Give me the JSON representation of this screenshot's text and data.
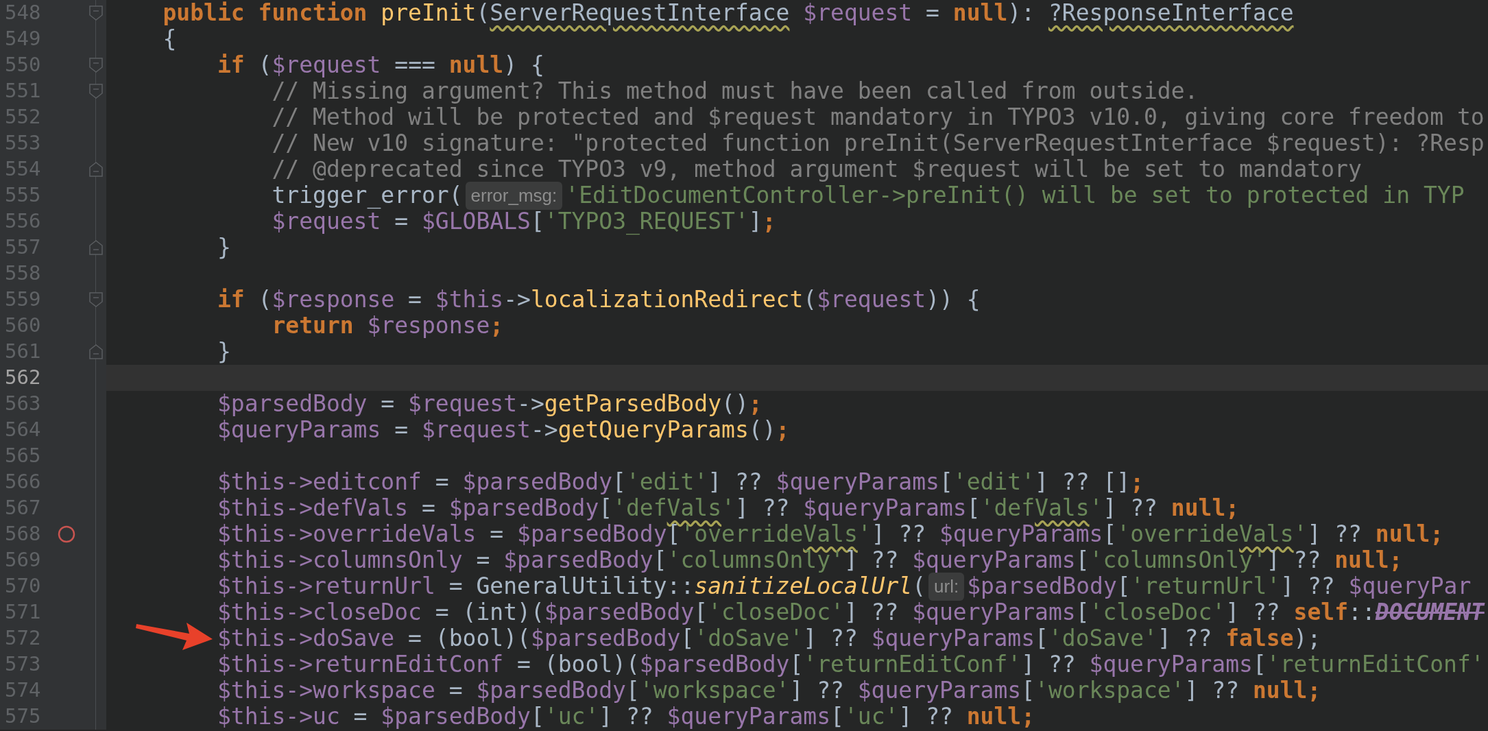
{
  "lines": [
    {
      "number": "548",
      "current": false,
      "breakpoint": false,
      "arrow": false,
      "fold_open": true,
      "fold_close": false,
      "tokens": [
        {
          "kind": "keyword",
          "text": "public function "
        },
        {
          "kind": "function",
          "text": "preInit"
        },
        {
          "kind": "plain",
          "text": "("
        },
        {
          "kind": "warning",
          "text": "ServerRequestInterface"
        },
        {
          "kind": "variable",
          "text": " $request"
        },
        {
          "kind": "plain",
          "text": " = "
        },
        {
          "kind": "keyword",
          "text": "null"
        },
        {
          "kind": "plain",
          "text": "): "
        },
        {
          "kind": "warning",
          "text": "?ResponseInterface"
        }
      ]
    },
    {
      "number": "549",
      "current": false,
      "breakpoint": false,
      "arrow": false,
      "fold_open": false,
      "fold_close": false,
      "tokens": [
        {
          "kind": "plain",
          "text": "{"
        }
      ],
      "children": [
        {
          "number": "550",
          "current": false,
          "breakpoint": false,
          "arrow": false,
          "fold_open": true,
          "fold_close": false,
          "tokens": [
            {
              "kind": "keyword",
              "text": "if"
            },
            {
              "kind": "plain",
              "text": " ("
            },
            {
              "kind": "variable",
              "text": "$request"
            },
            {
              "kind": "plain",
              "text": " === "
            },
            {
              "kind": "keyword",
              "text": "null"
            },
            {
              "kind": "plain",
              "text": ") {"
            }
          ],
          "children": [
            {
              "number": "551",
              "current": false,
              "breakpoint": false,
              "arrow": false,
              "fold_open": true,
              "fold_close": false,
              "tokens": [
                {
                  "kind": "comment",
                  "text": "// Missing argument? This method must have been called from outside."
                }
              ]
            },
            {
              "number": "552",
              "current": false,
              "breakpoint": false,
              "arrow": false,
              "fold_open": false,
              "fold_close": false,
              "tokens": [
                {
                  "kind": "comment",
                  "text": "// Method will be protected and $request mandatory in TYPO3 v10.0, giving core freedom to"
                }
              ]
            },
            {
              "number": "553",
              "current": false,
              "breakpoint": false,
              "arrow": false,
              "fold_open": false,
              "fold_close": false,
              "tokens": [
                {
                  "kind": "comment",
                  "text": "// New v10 signature: \"protected function preInit(ServerRequestInterface $request): ?Resp"
                }
              ]
            },
            {
              "number": "554",
              "current": false,
              "breakpoint": false,
              "arrow": false,
              "fold_open": false,
              "fold_close": true,
              "tokens": [
                {
                  "kind": "comment",
                  "text": "// @deprecated since TYPO3 v9, method argument $request will be set to mandatory"
                }
              ]
            },
            {
              "number": "555",
              "current": false,
              "breakpoint": false,
              "arrow": false,
              "fold_open": false,
              "fold_close": false,
              "tokens": [
                {
                  "kind": "plain",
                  "text": "trigger_error("
                },
                {
                  "kind": "hint",
                  "text": "error_msg:"
                },
                {
                  "kind": "string",
                  "text": "'EditDocumentController->preInit() will be set to protected in TYP"
                }
              ]
            },
            {
              "number": "556",
              "current": false,
              "breakpoint": false,
              "arrow": false,
              "fold_open": false,
              "fold_close": false,
              "tokens": [
                {
                  "kind": "variable",
                  "text": "$request"
                },
                {
                  "kind": "plain",
                  "text": " = "
                },
                {
                  "kind": "variable",
                  "text": "$GLOBALS"
                },
                {
                  "kind": "plain",
                  "text": "["
                },
                {
                  "kind": "string",
                  "text": "'TYPO3_REQUEST'"
                },
                {
                  "kind": "plain",
                  "text": "]"
                },
                {
                  "kind": "keyword",
                  "text": ";"
                }
              ]
            }
          ]
        },
        {
          "number": "557",
          "current": false,
          "breakpoint": false,
          "arrow": false,
          "fold_open": false,
          "fold_close": true,
          "tokens": [
            {
              "kind": "plain",
              "text": "}"
            }
          ]
        },
        {
          "number": "558",
          "current": false,
          "breakpoint": false,
          "arrow": false,
          "fold_open": false,
          "fold_close": false
        },
        {
          "number": "559",
          "current": false,
          "breakpoint": false,
          "arrow": false,
          "fold_open": true,
          "fold_close": false,
          "tokens": [
            {
              "kind": "keyword",
              "text": "if"
            },
            {
              "kind": "plain",
              "text": " ("
            },
            {
              "kind": "variable",
              "text": "$response"
            },
            {
              "kind": "plain",
              "text": " = "
            },
            {
              "kind": "variable",
              "text": "$this"
            },
            {
              "kind": "plain",
              "text": "->"
            },
            {
              "kind": "function",
              "text": "localizationRedirect"
            },
            {
              "kind": "plain",
              "text": "("
            },
            {
              "kind": "variable",
              "text": "$request"
            },
            {
              "kind": "plain",
              "text": ")) {"
            }
          ],
          "children": [
            {
              "number": "560",
              "current": false,
              "breakpoint": false,
              "arrow": false,
              "fold_open": false,
              "fold_close": false,
              "tokens": [
                {
                  "kind": "keyword",
                  "text": "return "
                },
                {
                  "kind": "variable",
                  "text": "$response"
                },
                {
                  "kind": "keyword",
                  "text": ";"
                }
              ]
            }
          ]
        },
        {
          "number": "561",
          "current": false,
          "breakpoint": false,
          "arrow": false,
          "fold_open": false,
          "fold_close": true,
          "tokens": [
            {
              "kind": "plain",
              "text": "}"
            }
          ]
        },
        {
          "number": "562",
          "current": true,
          "breakpoint": false,
          "arrow": false,
          "fold_open": false,
          "fold_close": false
        },
        {
          "number": "563",
          "current": false,
          "breakpoint": false,
          "arrow": false,
          "fold_open": false,
          "fold_close": false,
          "tokens": [
            {
              "kind": "variable",
              "text": "$parsedBody"
            },
            {
              "kind": "plain",
              "text": " = "
            },
            {
              "kind": "variable",
              "text": "$request"
            },
            {
              "kind": "plain",
              "text": "->"
            },
            {
              "kind": "function",
              "text": "getParsedBody"
            },
            {
              "kind": "plain",
              "text": "()"
            },
            {
              "kind": "keyword",
              "text": ";"
            }
          ]
        },
        {
          "number": "564",
          "current": false,
          "breakpoint": false,
          "arrow": false,
          "fold_open": false,
          "fold_close": false,
          "tokens": [
            {
              "kind": "variable",
              "text": "$queryParams"
            },
            {
              "kind": "plain",
              "text": " = "
            },
            {
              "kind": "variable",
              "text": "$request"
            },
            {
              "kind": "plain",
              "text": "->"
            },
            {
              "kind": "function",
              "text": "getQueryParams"
            },
            {
              "kind": "plain",
              "text": "()"
            },
            {
              "kind": "keyword",
              "text": ";"
            }
          ]
        },
        {
          "number": "565",
          "current": false,
          "breakpoint": false,
          "arrow": false,
          "fold_open": false,
          "fold_close": false
        },
        {
          "number": "566",
          "current": false,
          "breakpoint": false,
          "arrow": false,
          "fold_open": false,
          "fold_close": false,
          "tokens": [
            {
              "kind": "variable",
              "text": "$this->editconf"
            },
            {
              "kind": "plain",
              "text": " = "
            },
            {
              "kind": "variable",
              "text": "$parsedBody"
            },
            {
              "kind": "plain",
              "text": "["
            },
            {
              "kind": "string",
              "text": "'edit'"
            },
            {
              "kind": "plain",
              "text": "] ?? "
            },
            {
              "kind": "variable",
              "text": "$queryParams"
            },
            {
              "kind": "plain",
              "text": "["
            },
            {
              "kind": "string",
              "text": "'edit'"
            },
            {
              "kind": "plain",
              "text": "] ?? []"
            },
            {
              "kind": "keyword",
              "text": ";"
            }
          ]
        },
        {
          "number": "567",
          "current": false,
          "breakpoint": false,
          "arrow": false,
          "fold_open": false,
          "fold_close": false,
          "tokens": [
            {
              "kind": "variable",
              "text": "$this->defVals"
            },
            {
              "kind": "plain",
              "text": " = "
            },
            {
              "kind": "variable",
              "text": "$parsedBody"
            },
            {
              "kind": "plain",
              "text": "["
            },
            {
              "kind": "string",
              "text": "'def"
            },
            {
              "kind": "stringwarning",
              "text": "Vals"
            },
            {
              "kind": "string",
              "text": "'"
            },
            {
              "kind": "plain",
              "text": "] ?? "
            },
            {
              "kind": "variable",
              "text": "$queryParams"
            },
            {
              "kind": "plain",
              "text": "["
            },
            {
              "kind": "string",
              "text": "'def"
            },
            {
              "kind": "stringwarning",
              "text": "Vals"
            },
            {
              "kind": "string",
              "text": "'"
            },
            {
              "kind": "plain",
              "text": "] ?? "
            },
            {
              "kind": "keyword",
              "text": "null;"
            }
          ]
        },
        {
          "number": "568",
          "current": false,
          "breakpoint": true,
          "arrow": false,
          "fold_open": false,
          "fold_close": false,
          "tokens": [
            {
              "kind": "variable",
              "text": "$this->overrideVals"
            },
            {
              "kind": "plain",
              "text": " = "
            },
            {
              "kind": "variable",
              "text": "$parsedBody"
            },
            {
              "kind": "plain",
              "text": "["
            },
            {
              "kind": "string",
              "text": "'override"
            },
            {
              "kind": "stringwarning",
              "text": "Vals"
            },
            {
              "kind": "string",
              "text": "'"
            },
            {
              "kind": "plain",
              "text": "] ?? "
            },
            {
              "kind": "variable",
              "text": "$queryParams"
            },
            {
              "kind": "plain",
              "text": "["
            },
            {
              "kind": "string",
              "text": "'override"
            },
            {
              "kind": "stringwarning",
              "text": "Vals"
            },
            {
              "kind": "string",
              "text": "'"
            },
            {
              "kind": "plain",
              "text": "] ?? "
            },
            {
              "kind": "keyword",
              "text": "null;"
            }
          ]
        },
        {
          "number": "569",
          "current": false,
          "breakpoint": false,
          "arrow": false,
          "fold_open": false,
          "fold_close": false,
          "tokens": [
            {
              "kind": "variable",
              "text": "$this->columnsOnly"
            },
            {
              "kind": "plain",
              "text": " = "
            },
            {
              "kind": "variable",
              "text": "$parsedBody"
            },
            {
              "kind": "plain",
              "text": "["
            },
            {
              "kind": "string",
              "text": "'columnsOnly'"
            },
            {
              "kind": "plain",
              "text": "] ?? "
            },
            {
              "kind": "variable",
              "text": "$queryParams"
            },
            {
              "kind": "plain",
              "text": "["
            },
            {
              "kind": "string",
              "text": "'columnsOnly'"
            },
            {
              "kind": "plain",
              "text": "] ?? "
            },
            {
              "kind": "keyword",
              "text": "null;"
            }
          ]
        },
        {
          "number": "570",
          "current": false,
          "breakpoint": false,
          "arrow": false,
          "fold_open": false,
          "fold_close": false,
          "tokens": [
            {
              "kind": "variable",
              "text": "$this->returnUrl"
            },
            {
              "kind": "plain",
              "text": " = GeneralUtility::"
            },
            {
              "kind": "static",
              "text": "sanitizeLocalUrl"
            },
            {
              "kind": "plain",
              "text": "("
            },
            {
              "kind": "hint",
              "text": "url:"
            },
            {
              "kind": "variable",
              "text": "$parsedBody"
            },
            {
              "kind": "plain",
              "text": "["
            },
            {
              "kind": "string",
              "text": "'returnUrl'"
            },
            {
              "kind": "plain",
              "text": "] ?? "
            },
            {
              "kind": "variable",
              "text": "$queryPar"
            }
          ]
        },
        {
          "number": "571",
          "current": false,
          "breakpoint": false,
          "arrow": false,
          "fold_open": false,
          "fold_close": false,
          "tokens": [
            {
              "kind": "variable",
              "text": "$this->closeDoc"
            },
            {
              "kind": "plain",
              "text": " = (int)("
            },
            {
              "kind": "variable",
              "text": "$parsedBody"
            },
            {
              "kind": "plain",
              "text": "["
            },
            {
              "kind": "string",
              "text": "'closeDoc'"
            },
            {
              "kind": "plain",
              "text": "] ?? "
            },
            {
              "kind": "variable",
              "text": "$queryParams"
            },
            {
              "kind": "plain",
              "text": "["
            },
            {
              "kind": "string",
              "text": "'closeDoc'"
            },
            {
              "kind": "plain",
              "text": "] ?? "
            },
            {
              "kind": "keyword",
              "text": "self"
            },
            {
              "kind": "plain",
              "text": "::"
            },
            {
              "kind": "deprecated",
              "text": "DOCUMENT"
            }
          ]
        },
        {
          "number": "572",
          "current": false,
          "breakpoint": false,
          "arrow": true,
          "fold_open": false,
          "fold_close": false,
          "tokens": [
            {
              "kind": "variable",
              "text": "$this->doSave"
            },
            {
              "kind": "plain",
              "text": " = (bool)("
            },
            {
              "kind": "variable",
              "text": "$parsedBody"
            },
            {
              "kind": "plain",
              "text": "["
            },
            {
              "kind": "string",
              "text": "'doSave'"
            },
            {
              "kind": "plain",
              "text": "] ?? "
            },
            {
              "kind": "variable",
              "text": "$queryParams"
            },
            {
              "kind": "plain",
              "text": "["
            },
            {
              "kind": "string",
              "text": "'doSave'"
            },
            {
              "kind": "plain",
              "text": "] ?? "
            },
            {
              "kind": "keyword",
              "text": "false"
            },
            {
              "kind": "plain",
              "text": ");"
            }
          ]
        },
        {
          "number": "573",
          "current": false,
          "breakpoint": false,
          "arrow": false,
          "fold_open": false,
          "fold_close": false,
          "tokens": [
            {
              "kind": "variable",
              "text": "$this->returnEditConf"
            },
            {
              "kind": "plain",
              "text": " = (bool)("
            },
            {
              "kind": "variable",
              "text": "$parsedBody"
            },
            {
              "kind": "plain",
              "text": "["
            },
            {
              "kind": "string",
              "text": "'returnEditConf'"
            },
            {
              "kind": "plain",
              "text": "] ?? "
            },
            {
              "kind": "variable",
              "text": "$queryParams"
            },
            {
              "kind": "plain",
              "text": "["
            },
            {
              "kind": "string",
              "text": "'returnEditConf'"
            }
          ]
        },
        {
          "number": "574",
          "current": false,
          "breakpoint": false,
          "arrow": false,
          "fold_open": false,
          "fold_close": false,
          "tokens": [
            {
              "kind": "variable",
              "text": "$this->workspace"
            },
            {
              "kind": "plain",
              "text": " = "
            },
            {
              "kind": "variable",
              "text": "$parsedBody"
            },
            {
              "kind": "plain",
              "text": "["
            },
            {
              "kind": "string",
              "text": "'workspace'"
            },
            {
              "kind": "plain",
              "text": "] ?? "
            },
            {
              "kind": "variable",
              "text": "$queryParams"
            },
            {
              "kind": "plain",
              "text": "["
            },
            {
              "kind": "string",
              "text": "'workspace'"
            },
            {
              "kind": "plain",
              "text": "] ?? "
            },
            {
              "kind": "keyword",
              "text": "null;"
            }
          ]
        },
        {
          "number": "575",
          "current": false,
          "breakpoint": false,
          "arrow": false,
          "fold_open": false,
          "fold_close": false,
          "tokens": [
            {
              "kind": "variable",
              "text": "$this->uc"
            },
            {
              "kind": "plain",
              "text": " = "
            },
            {
              "kind": "variable",
              "text": "$parsedBody"
            },
            {
              "kind": "plain",
              "text": "["
            },
            {
              "kind": "string",
              "text": "'uc'"
            },
            {
              "kind": "plain",
              "text": "] ?? "
            },
            {
              "kind": "variable",
              "text": "$queryParams"
            },
            {
              "kind": "plain",
              "text": "["
            },
            {
              "kind": "string",
              "text": "'uc'"
            },
            {
              "kind": "plain",
              "text": "] ?? "
            },
            {
              "kind": "keyword",
              "text": "null;"
            }
          ]
        }
      ]
    }
  ]
}
